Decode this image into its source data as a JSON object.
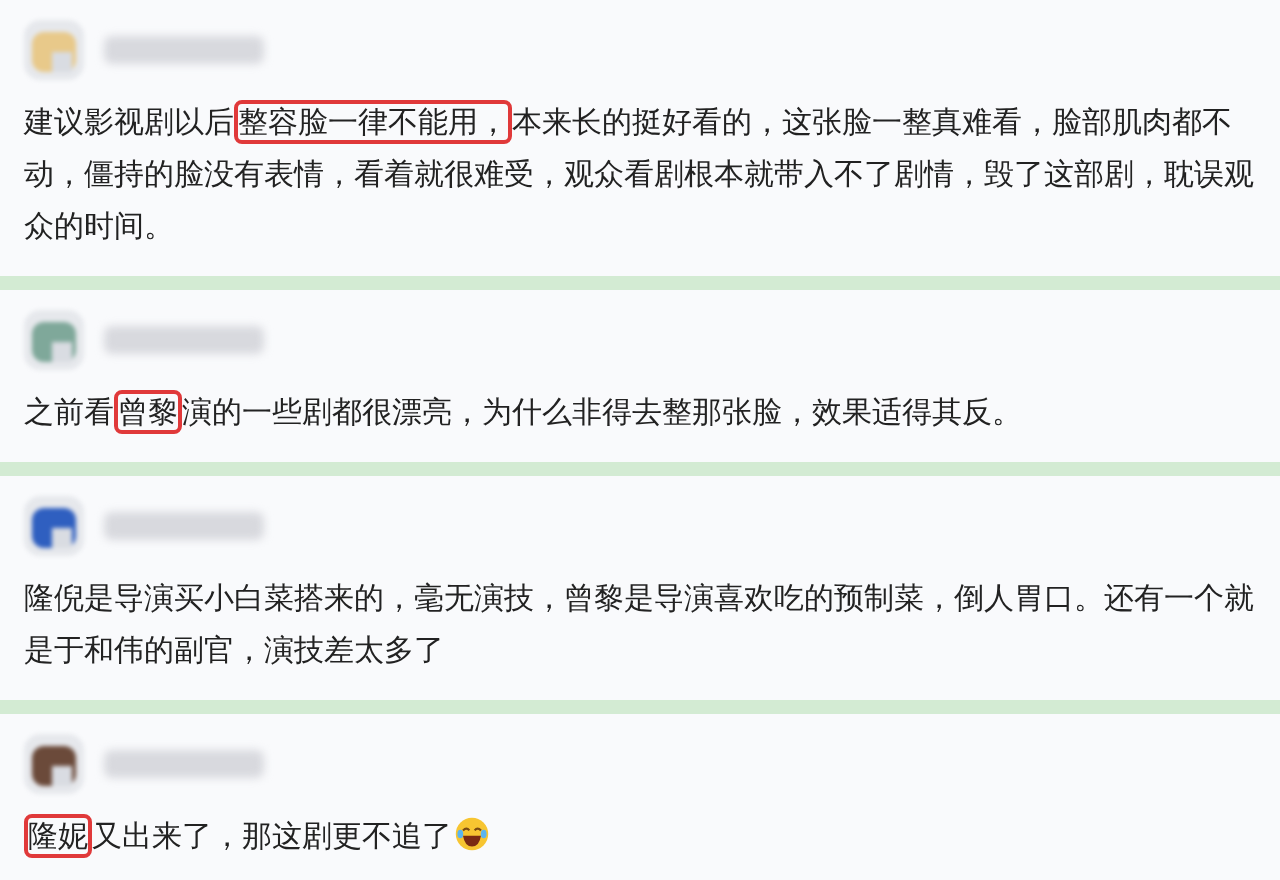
{
  "comments": [
    {
      "segments": [
        {
          "text": "建议影视剧以后",
          "highlighted": false
        },
        {
          "text": "整容脸一律不能用，",
          "highlighted": true
        },
        {
          "text": "本来长的挺好看的，这张脸一整真难看，脸部肌肉都不动，僵持的脸没有表情，看着就很难受，观众看剧根本就带入不了剧情，毁了这部剧，耽误观众的时间。",
          "highlighted": false
        }
      ]
    },
    {
      "segments": [
        {
          "text": "之前看",
          "highlighted": false
        },
        {
          "text": "曾黎",
          "highlighted": true
        },
        {
          "text": "演的一些剧都很漂亮，为什么非得去整那张脸，效果适得其反。",
          "highlighted": false
        }
      ]
    },
    {
      "segments": [
        {
          "text": "隆倪是导演买小白菜搭来的，毫无演技，曾黎是导演喜欢吃的预制菜，倒人胃口。还有一个就是于和伟的副官，演技差太多了",
          "highlighted": false
        }
      ]
    },
    {
      "segments": [
        {
          "text": "隆妮",
          "highlighted": true
        },
        {
          "text": "又出来了，那这剧更不追了",
          "highlighted": false
        },
        {
          "kind": "emoji"
        }
      ]
    }
  ]
}
